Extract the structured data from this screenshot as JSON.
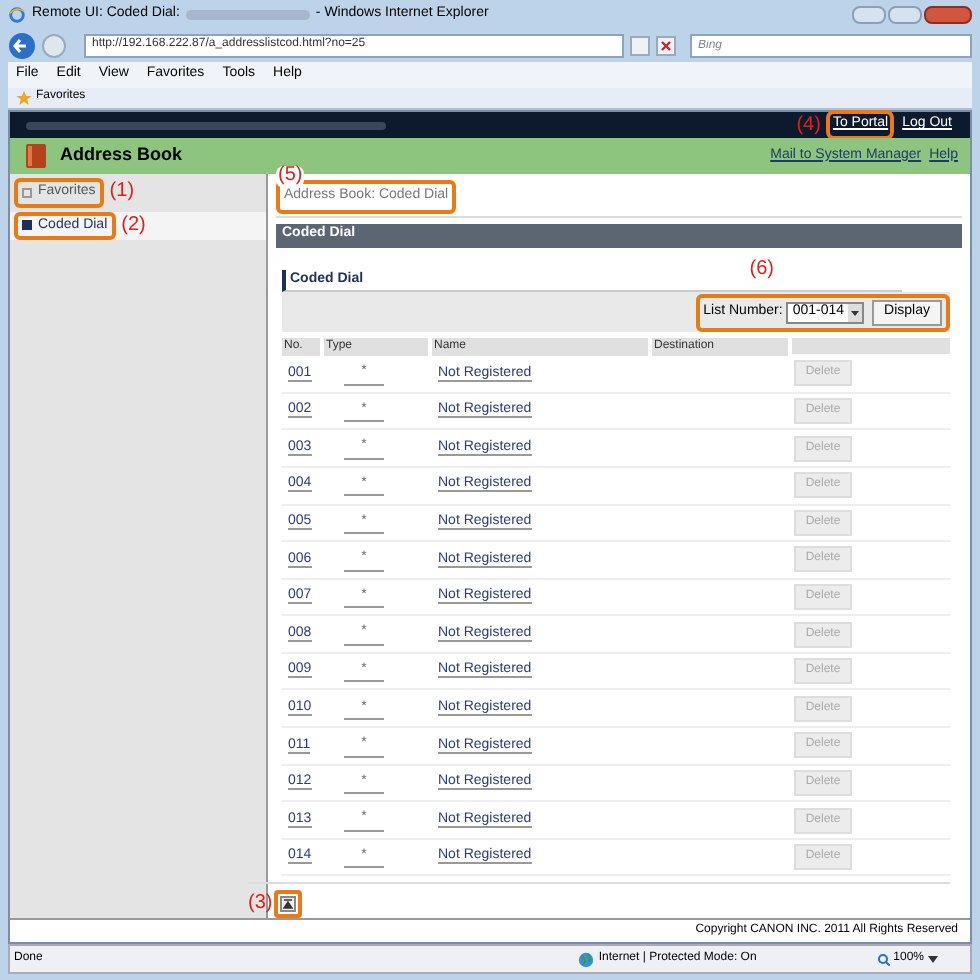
{
  "window": {
    "title_prefix": "Remote UI: Coded Dial:",
    "title_suffix": "- Windows Internet Explorer"
  },
  "address_bar": {
    "url": "http://192.168.222.87/a_addresslistcod.html?no=25",
    "search_placeholder": "Bing"
  },
  "menu": [
    "File",
    "Edit",
    "View",
    "Favorites",
    "Tools",
    "Help"
  ],
  "favorites_bar": {
    "label": "Favorites"
  },
  "header": {
    "links": [
      {
        "label": "To Portal",
        "callout": "(4)"
      },
      {
        "label": "Log Out"
      }
    ],
    "title": "Address Book",
    "sub_links": [
      "Mail to System Manager",
      "Help"
    ]
  },
  "sidebar": {
    "items": [
      {
        "label": "Favorites",
        "selected": false,
        "callout": "(1)"
      },
      {
        "label": "Coded Dial",
        "selected": true,
        "callout": "(2)"
      }
    ]
  },
  "breadcrumb": {
    "text": "Address Book: Coded Dial",
    "callout": "(5)"
  },
  "section_title": "Coded Dial",
  "subsection_title": "Coded Dial",
  "list_number": {
    "label": "List Number:",
    "value": "001-014",
    "button": "Display",
    "callout": "(6)"
  },
  "table": {
    "columns": [
      "No.",
      "Type",
      "Name",
      "Destination"
    ],
    "rows": [
      {
        "no": "001",
        "type": "*",
        "name": "Not Registered",
        "action": "Delete",
        "disabled": true
      },
      {
        "no": "002",
        "type": "*",
        "name": "Not Registered",
        "action": "Delete",
        "disabled": true
      },
      {
        "no": "003",
        "type": "*",
        "name": "Not Registered",
        "action": "Delete",
        "disabled": true
      },
      {
        "no": "004",
        "type": "*",
        "name": "Not Registered",
        "action": "Delete",
        "disabled": true
      },
      {
        "no": "005",
        "type": "*",
        "name": "Not Registered",
        "action": "Delete",
        "disabled": true
      },
      {
        "no": "006",
        "type": "*",
        "name": "Not Registered",
        "action": "Delete",
        "disabled": true
      },
      {
        "no": "007",
        "type": "*",
        "name": "Not Registered",
        "action": "Delete",
        "disabled": true
      },
      {
        "no": "008",
        "type": "*",
        "name": "Not Registered",
        "action": "Delete",
        "disabled": true
      },
      {
        "no": "009",
        "type": "*",
        "name": "Not Registered",
        "action": "Delete",
        "disabled": true
      },
      {
        "no": "010",
        "type": "*",
        "name": "Not Registered",
        "action": "Delete",
        "disabled": true
      },
      {
        "no": "011",
        "type": "*",
        "name": "Not Registered",
        "action": "Delete",
        "disabled": true
      },
      {
        "no": "012",
        "type": "*",
        "name": "Not Registered",
        "action": "Delete",
        "disabled": true
      },
      {
        "no": "013",
        "type": "*",
        "name": "Not Registered",
        "action": "Delete",
        "disabled": true
      },
      {
        "no": "014",
        "type": "*",
        "name": "Not Registered",
        "action": "Delete",
        "disabled": true
      }
    ]
  },
  "page_top": {
    "callout": "(3)"
  },
  "copyright": "Copyright CANON INC. 2011 All Rights Reserved",
  "status_bar": {
    "left": "Done",
    "zone": "Internet | Protected Mode: On",
    "zoom": "100%"
  }
}
